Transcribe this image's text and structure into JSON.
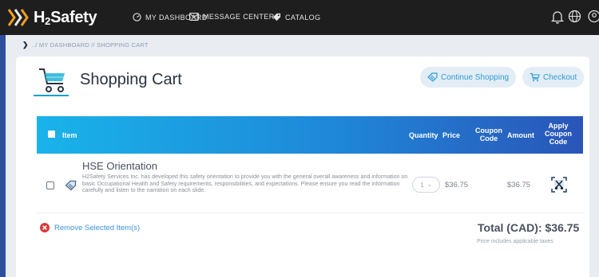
{
  "brand": {
    "name_prefix": "H",
    "name_sub": "2",
    "name_suffix": "Safety"
  },
  "nav": {
    "dashboard": "MY DASHBOARD",
    "messages": "MESSAGE CENTER",
    "catalog": "CATALOG"
  },
  "breadcrumb": "../ MY DASHBOARD // SHOPPING CART",
  "page": {
    "title": "Shopping Cart"
  },
  "actions": {
    "continue": "Continue Shopping",
    "checkout": "Checkout"
  },
  "table": {
    "headers": {
      "item": "Item",
      "quantity": "Quantity",
      "price": "Price",
      "coupon_code": "Coupon Code",
      "amount": "Amount",
      "apply_coupon": "Apply Coupon Code"
    },
    "rows": [
      {
        "title": "HSE Orientation",
        "description": "H2Safety Services Inc. has developed this safety orientation to provide you with the general overall awareness and information on basic Occupational Health and Safety requirements, responsibilities, and expectations. Please ensure you read the information carefully and listen to the narration on each slide.",
        "quantity": "1",
        "price": "$36.75",
        "amount": "$36.75"
      }
    ]
  },
  "footer": {
    "remove": "Remove Selected Item(s)",
    "total": "Total (CAD): $36.75",
    "tax_note": "Price includes applicable taxes"
  },
  "colors": {
    "accent": "#17a2c9",
    "header_start": "#19b3ea",
    "header_end": "#2a55b8",
    "topbar": "#1e1e1e",
    "danger": "#d63a3a"
  }
}
